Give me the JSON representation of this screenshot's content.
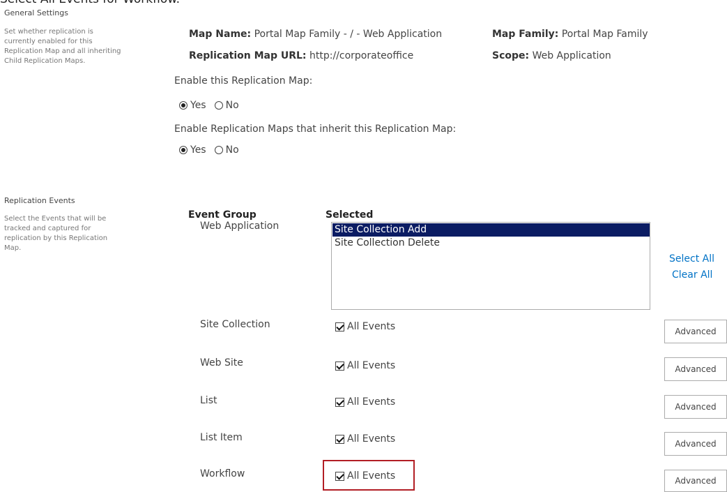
{
  "caption": "Select All Events for Workflow.",
  "general": {
    "title": "General Settings",
    "description": "Set whether replication is currently enabled for this Replication Map and all inheriting Child Replication Maps.",
    "map_name_label": "Map Name:",
    "map_name_value": "Portal Map Family - / - Web Application",
    "map_family_label": "Map Family:",
    "map_family_value": "Portal Map Family",
    "map_url_label": "Replication Map URL:",
    "map_url_value": "http://corporateoffice",
    "scope_label": "Scope:",
    "scope_value": "Web Application",
    "enable_map_label": "Enable this Replication Map:",
    "enable_map_selected": "Yes",
    "enable_inherit_label": "Enable Replication Maps that inherit this Replication Map:",
    "enable_inherit_selected": "Yes",
    "yes_label": "Yes",
    "no_label": "No"
  },
  "events": {
    "title": "Replication Events",
    "description": "Select the Events that will be tracked and captured for replication by this Replication Map.",
    "col_event_group": "Event Group",
    "col_selected": "Selected",
    "web_app_label": "Web Application",
    "listbox_items": [
      {
        "label": "Site Collection Add",
        "selected": true
      },
      {
        "label": "Site Collection Delete",
        "selected": false
      }
    ],
    "select_all": "Select All",
    "clear_all": "Clear All",
    "groups": [
      {
        "label": "Site Collection",
        "checkbox_label": "All Events",
        "checked": true,
        "button": "Advanced"
      },
      {
        "label": "Web Site",
        "checkbox_label": "All Events",
        "checked": true,
        "button": "Advanced"
      },
      {
        "label": "List",
        "checkbox_label": "All Events",
        "checked": true,
        "button": "Advanced"
      },
      {
        "label": "List Item",
        "checkbox_label": "All Events",
        "checked": true,
        "button": "Advanced"
      },
      {
        "label": "Workflow",
        "checkbox_label": "All Events",
        "checked": true,
        "button": "Advanced",
        "highlighted": true
      }
    ]
  },
  "colors": {
    "link": "#0072c6",
    "list_selection": "#0b1c63",
    "highlight_border": "#b21e24"
  }
}
